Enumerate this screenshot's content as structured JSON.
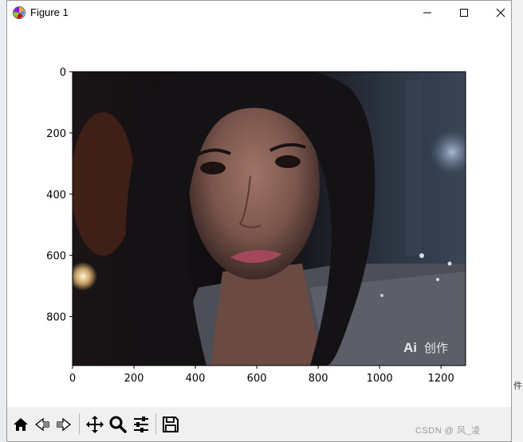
{
  "window": {
    "title": "Figure 1"
  },
  "plot": {
    "x_ticks": [
      "0",
      "200",
      "400",
      "600",
      "800",
      "1000",
      "1200"
    ],
    "y_ticks": [
      "0",
      "200",
      "400",
      "600",
      "800"
    ]
  },
  "image_overlay": {
    "badge_text": "创作"
  },
  "watermark": "CSDN @ 风_凌",
  "edge_text": "件",
  "toolbar": {
    "buttons": [
      "home-icon",
      "back-icon",
      "forward-icon",
      "pan-icon",
      "zoom-icon",
      "configure-subplots-icon",
      "save-icon"
    ]
  }
}
